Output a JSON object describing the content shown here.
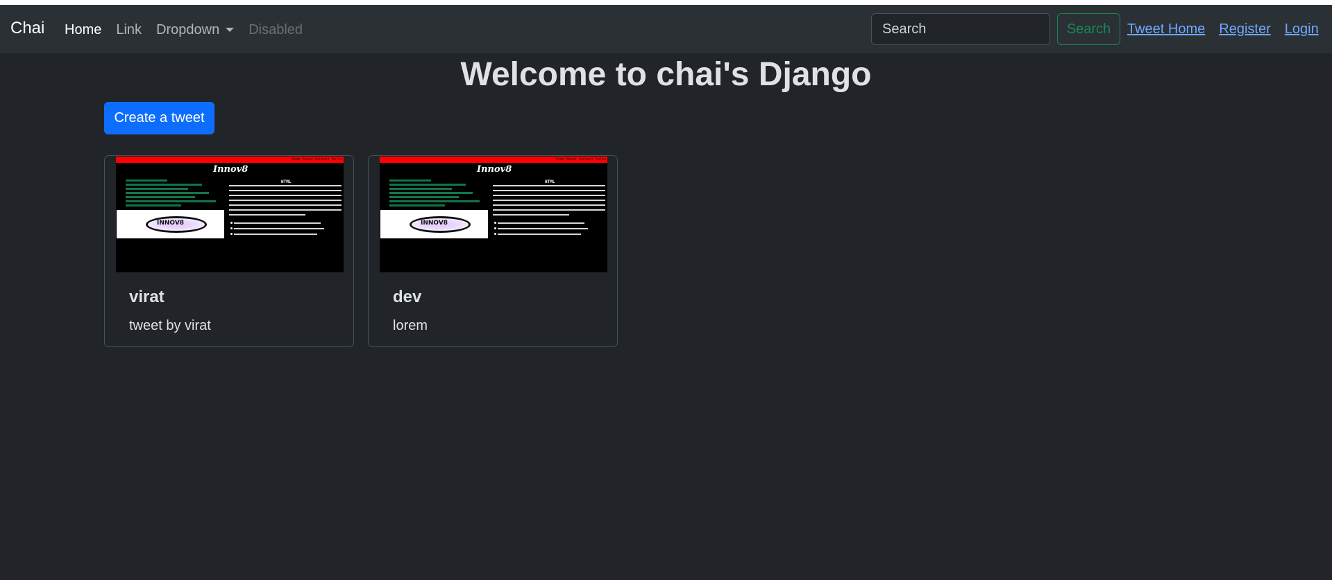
{
  "navbar": {
    "brand": "Chai",
    "links": [
      {
        "label": "Home"
      },
      {
        "label": "Link"
      },
      {
        "label": "Dropdown"
      },
      {
        "label": "Disabled"
      }
    ],
    "search_placeholder": "Search",
    "search_button": "Search",
    "right_links": [
      {
        "label": "Tweet Home"
      },
      {
        "label": "Register"
      },
      {
        "label": "Login"
      }
    ]
  },
  "main": {
    "title": "Welcome to chai's Django",
    "create_button": "Create a tweet",
    "cards": [
      {
        "title": "virat",
        "text": "tweet by virat",
        "image": {
          "logo": "Innov8",
          "heading": "HTML",
          "tiny_nav": "Home About Contact Rules"
        }
      },
      {
        "title": "dev",
        "text": "lorem",
        "image": {
          "logo": "Innov8",
          "heading": "HTML",
          "tiny_nav": "Home About Contact Rules"
        }
      }
    ]
  },
  "colors": {
    "background": "#212529",
    "navbar": "#2b3035",
    "primary": "#0d6efd",
    "success": "#198754",
    "link": "#6ea8fe"
  }
}
